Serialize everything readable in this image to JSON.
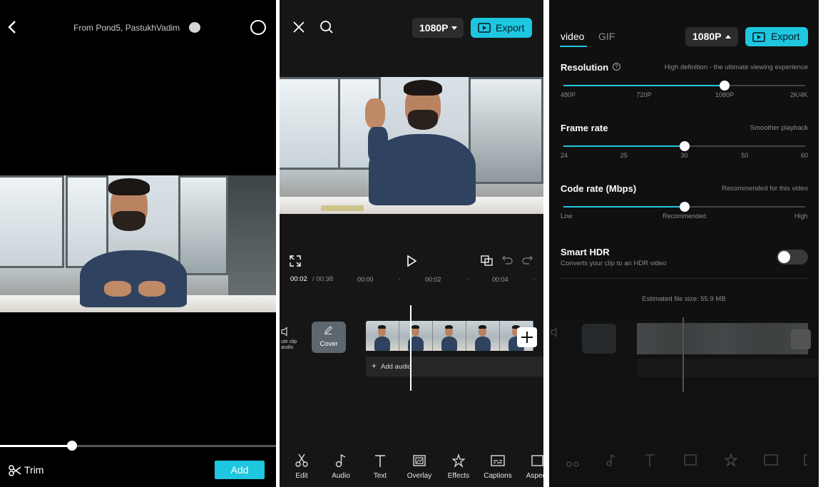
{
  "preview": {
    "credit": "From Pond5,  PastukhVadim",
    "trim_label": "Trim",
    "add_label": "Add",
    "scrub_progress": 0.26
  },
  "editor": {
    "resolution_label": "1080P",
    "export_label": "Export",
    "time_current": "00:02",
    "time_total": "/ 00:38",
    "ruler": [
      "00:00",
      "00:02",
      "00:04"
    ],
    "mute_label": "ute clip audio",
    "cover_label": "Cover",
    "add_audio_label": "Add audio",
    "tools": [
      {
        "label": "Edit",
        "icon": "scissors-icon"
      },
      {
        "label": "Audio",
        "icon": "music-note-icon"
      },
      {
        "label": "Text",
        "icon": "text-icon"
      },
      {
        "label": "Overlay",
        "icon": "overlay-icon"
      },
      {
        "label": "Effects",
        "icon": "effects-star-icon"
      },
      {
        "label": "Captions",
        "icon": "captions-icon"
      },
      {
        "label": "Aspect",
        "icon": "aspect-icon"
      }
    ]
  },
  "export_settings": {
    "tab_video": "video",
    "tab_gif": "GIF",
    "resolution_label": "1080P",
    "export_label": "Export",
    "resolution": {
      "title": "Resolution",
      "hint": "High definition - the ultimate viewing experience",
      "ticks": [
        "480P",
        "720P",
        "1080P",
        "2K/4K"
      ],
      "selected_index": 2
    },
    "frame_rate": {
      "title": "Frame rate",
      "hint": "Smoother playback",
      "ticks": [
        "24",
        "25",
        "30",
        "50",
        "60"
      ],
      "selected_index": 2
    },
    "code_rate": {
      "title": "Code rate (Mbps)",
      "hint": "Recommended for this video",
      "ticks": [
        "Low",
        "Recommended",
        "High"
      ],
      "selected_index": 1
    },
    "smart_hdr": {
      "title": "Smart HDR",
      "subtitle": "Converts your clip to an HDR video",
      "enabled": false
    },
    "file_size": "Estimated file size: 55.9 MB"
  },
  "colors": {
    "accent": "#1ec6e0"
  }
}
